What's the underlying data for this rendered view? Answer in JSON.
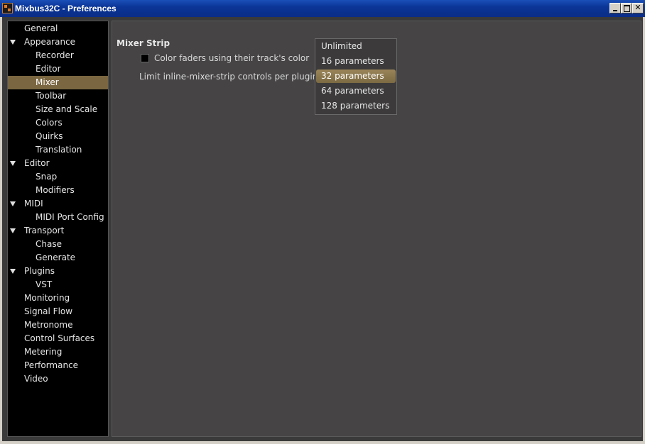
{
  "window": {
    "title": "Mixbus32C - Preferences"
  },
  "sidebar": {
    "items": [
      {
        "label": "General",
        "level": 0,
        "expanded": false,
        "selected": false
      },
      {
        "label": "Appearance",
        "level": 0,
        "expanded": true,
        "selected": false
      },
      {
        "label": "Recorder",
        "level": 1,
        "selected": false
      },
      {
        "label": "Editor",
        "level": 1,
        "selected": false
      },
      {
        "label": "Mixer",
        "level": 1,
        "selected": true
      },
      {
        "label": "Toolbar",
        "level": 1,
        "selected": false
      },
      {
        "label": "Size and Scale",
        "level": 1,
        "selected": false
      },
      {
        "label": "Colors",
        "level": 1,
        "selected": false
      },
      {
        "label": "Quirks",
        "level": 1,
        "selected": false
      },
      {
        "label": "Translation",
        "level": 1,
        "selected": false
      },
      {
        "label": "Editor",
        "level": 0,
        "expanded": true,
        "selected": false
      },
      {
        "label": "Snap",
        "level": 1,
        "selected": false
      },
      {
        "label": "Modifiers",
        "level": 1,
        "selected": false
      },
      {
        "label": "MIDI",
        "level": 0,
        "expanded": true,
        "selected": false
      },
      {
        "label": "MIDI Port Config",
        "level": 1,
        "selected": false
      },
      {
        "label": "Transport",
        "level": 0,
        "expanded": true,
        "selected": false
      },
      {
        "label": "Chase",
        "level": 1,
        "selected": false
      },
      {
        "label": "Generate",
        "level": 1,
        "selected": false
      },
      {
        "label": "Plugins",
        "level": 0,
        "expanded": true,
        "selected": false
      },
      {
        "label": "VST",
        "level": 1,
        "selected": false
      },
      {
        "label": "Monitoring",
        "level": 0,
        "expanded": false,
        "selected": false
      },
      {
        "label": "Signal Flow",
        "level": 0,
        "expanded": false,
        "selected": false
      },
      {
        "label": "Metronome",
        "level": 0,
        "expanded": false,
        "selected": false
      },
      {
        "label": "Control Surfaces",
        "level": 0,
        "expanded": false,
        "selected": false
      },
      {
        "label": "Metering",
        "level": 0,
        "expanded": false,
        "selected": false
      },
      {
        "label": "Performance",
        "level": 0,
        "expanded": false,
        "selected": false
      },
      {
        "label": "Video",
        "level": 0,
        "expanded": false,
        "selected": false
      }
    ]
  },
  "mixer_strip": {
    "section_title": "Mixer Strip",
    "color_faders_label": "Color faders using their track's color",
    "color_faders_checked": false,
    "limit_label": "Limit inline-mixer-strip controls per plugin:",
    "dropdown_options": [
      "Unlimited",
      "16 parameters",
      "32 parameters",
      "64 parameters",
      "128 parameters"
    ],
    "dropdown_selected": "32 parameters"
  },
  "colors": {
    "selection": "#7a6640",
    "titlebar": "#0b3597",
    "panel": "#464444",
    "sidebar": "#000000"
  }
}
